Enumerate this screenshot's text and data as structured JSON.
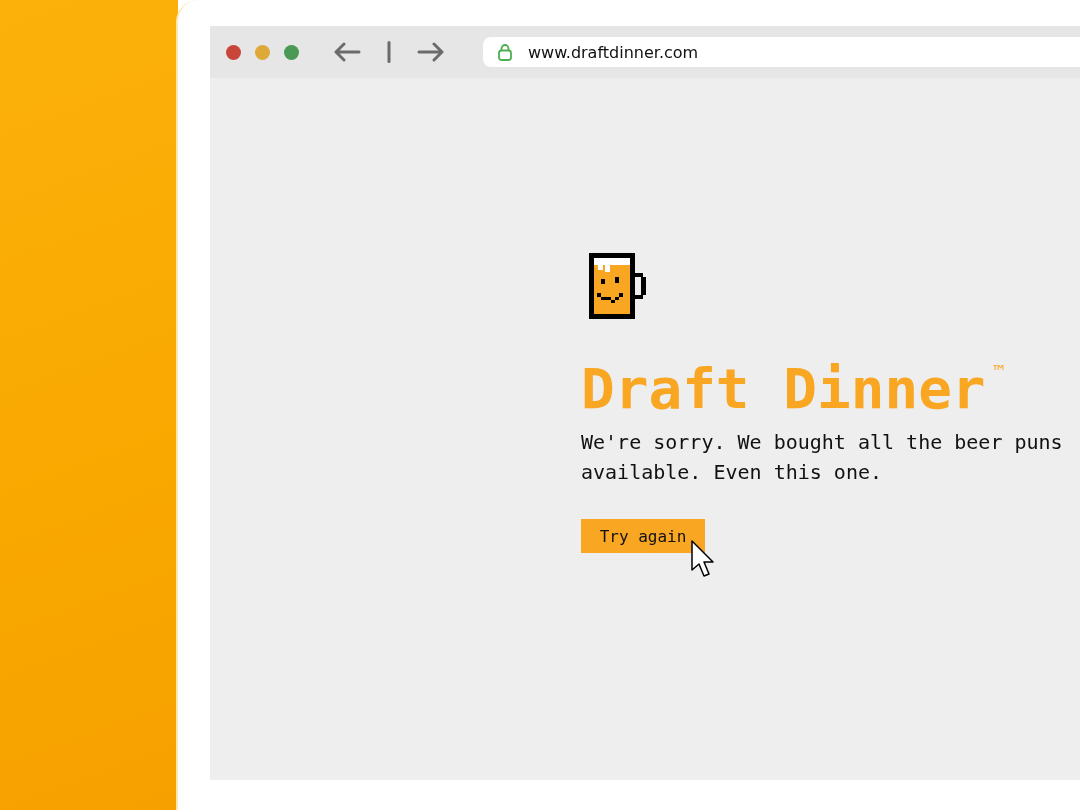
{
  "browser": {
    "url": "www.draftdinner.com"
  },
  "page": {
    "title": "Draft Dinner",
    "trademark": "™",
    "message": "We're sorry. We bought all the beer puns available. Even this one.",
    "button": "Try again"
  }
}
